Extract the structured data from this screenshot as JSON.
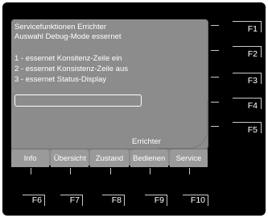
{
  "screen": {
    "title_line1": "Servicefunktionen Errichter",
    "title_line2": "Auswahl Debug-Mode essernet",
    "options": [
      {
        "label": "1  -  essernet Konsitenz-Zeile ein"
      },
      {
        "label": "2  -  essernet Konsistenz-Zeile aus"
      },
      {
        "label": "3  -  essernet Status-Display"
      }
    ],
    "selected_index": 2,
    "user_role": "Errichter"
  },
  "tabs": [
    "Info",
    "Übersicht",
    "Zustand",
    "Bedienen",
    "Service"
  ],
  "right_keys": [
    "F1",
    "F2",
    "F3",
    "F4",
    "F5"
  ],
  "bottom_keys": [
    "F6",
    "F7",
    "F8",
    "F9",
    "F10"
  ],
  "colors": {
    "bezel": "#000000",
    "screen": "#8c8c8c",
    "text": "#ffffff"
  }
}
